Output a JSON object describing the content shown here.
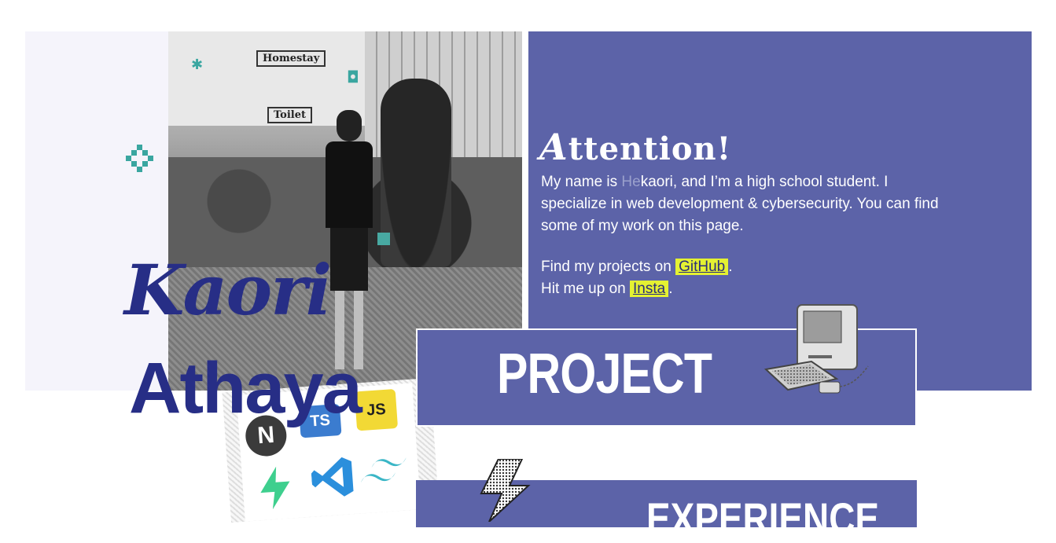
{
  "attention": {
    "title_prefix": "A",
    "title_rest": "ttention!"
  },
  "intro": {
    "lead": "My name is ",
    "faded": "He",
    "rest": "kaori, and I’m a high school student. I specialize in web development & cybersecurity. You can find some of my work on this page."
  },
  "links": {
    "github_prefix": "Find my projects on ",
    "github_label": "GitHub",
    "github_suffix": ".",
    "insta_prefix": "Hit me up on ",
    "insta_label": "Insta",
    "insta_suffix": "."
  },
  "name": {
    "first": "Kaori",
    "last": "Athaya"
  },
  "photo_signs": {
    "homestay": "Homestay",
    "toilet": "Toilet"
  },
  "tech": {
    "js": "JS",
    "ts": "TS",
    "next": "N"
  },
  "sections": {
    "project": "PROJECT",
    "experience": "EXPERIENCE"
  },
  "colors": {
    "panel": "#5c63a8",
    "name": "#272e86",
    "highlight": "#e4f132",
    "accent_teal": "#3aa6a0"
  },
  "icons": [
    "pixel-diamond-icon",
    "sparkle-icon",
    "ring-icon",
    "macintosh-computer-icon",
    "lightning-bolt-icon",
    "nextjs-icon",
    "typescript-icon",
    "javascript-icon",
    "supabase-icon",
    "vscode-icon",
    "tailwind-icon"
  ]
}
